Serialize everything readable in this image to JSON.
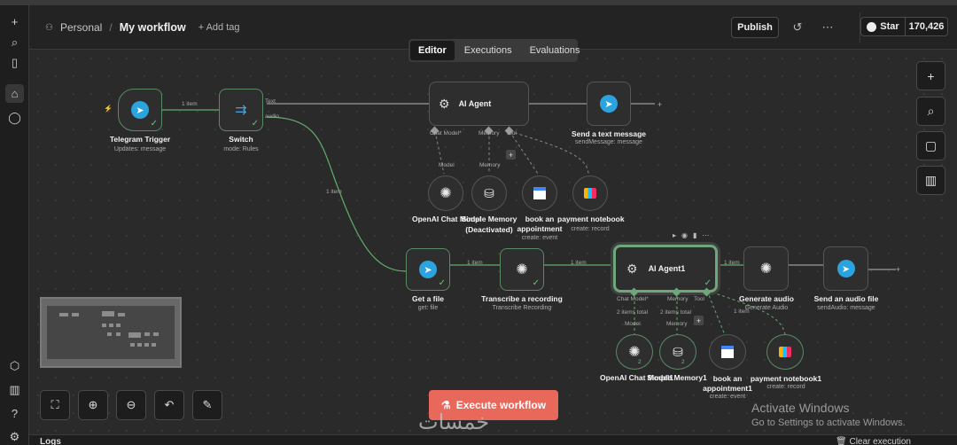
{
  "header": {
    "breadcrumb_project": "Personal",
    "breadcrumb_sep": "/",
    "workflow_name": "My workflow",
    "add_tag": "+ Add tag",
    "publish": "Publish",
    "star": "Star",
    "star_count": "170,426"
  },
  "tabs": {
    "editor": "Editor",
    "executions": "Executions",
    "evaluations": "Evaluations"
  },
  "nodes": {
    "telegram_trigger": {
      "title": "Telegram Trigger",
      "sub": "Updates: message"
    },
    "switch": {
      "title": "Switch",
      "sub": "mode: Rules",
      "out1": "Text",
      "out2": "audio"
    },
    "ai_agent": {
      "title": "AI Agent",
      "p1": "Chat Model*",
      "p2": "Memory",
      "p3": "Tool"
    },
    "send_text": {
      "title": "Send a text message",
      "sub": "sendMessage: message"
    },
    "openai_chat": {
      "title": "OpenAI Chat Model"
    },
    "simple_memory": {
      "title": "Simple Memory",
      "title2": "(Deactivated)"
    },
    "book": {
      "title": "book an",
      "title2": "appointment",
      "sub": "create: event"
    },
    "payment": {
      "title": "payment notebook",
      "sub": "create: record"
    },
    "get_file": {
      "title": "Get a file",
      "sub": "get: file"
    },
    "transcribe": {
      "title": "Transcribe a recording",
      "sub": "Transcribe Recording"
    },
    "ai_agent1": {
      "title": "AI Agent1",
      "p1": "Chat Model*",
      "p2": "Memory",
      "p3": "Tool",
      "items1": "2 items total",
      "items2": "2 items total"
    },
    "generate_audio": {
      "title": "Generate audio",
      "sub": "Generate Audio"
    },
    "send_audio": {
      "title": "Send an audio file",
      "sub": "sendAudio: message"
    },
    "openai_chat1": {
      "title": "OpenAI Chat Model1",
      "count": "2"
    },
    "simple_memory1": {
      "title": "Simple Memory1",
      "count": "2"
    },
    "book1": {
      "title": "book an",
      "title2": "appointment1",
      "sub": "create: event"
    },
    "payment1": {
      "title": "payment notebook1",
      "sub": "create: record"
    }
  },
  "edge_labels": {
    "tg_switch": "1 item",
    "switch_getfile": "1 item",
    "getfile_transcribe": "1 item",
    "transcribe_agent1": "1 item",
    "agent1_gen": "1 item",
    "agent1_payment": "1 item",
    "model": "Model",
    "memory": "Memory",
    "model1": "Model",
    "memory1": "Memory"
  },
  "execute": "Execute workflow",
  "logs": {
    "title": "Logs",
    "clear": "Clear execution"
  },
  "watermark": {
    "line1": "Activate Windows",
    "line2": "Go to Settings to activate Windows."
  },
  "overlay": "خمسات",
  "colors": {
    "accent": "#e8685c",
    "success": "#6ec27a",
    "telegram": "#2aa3df"
  }
}
